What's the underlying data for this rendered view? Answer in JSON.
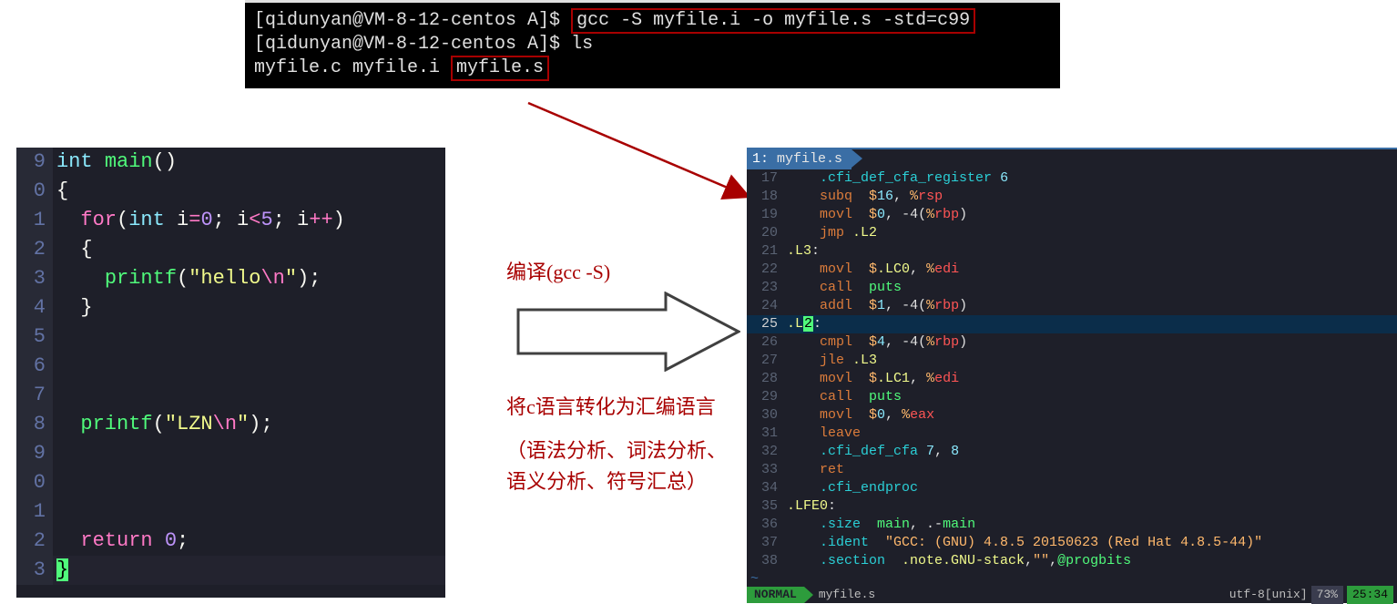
{
  "terminal": {
    "prompt": "[qidunyan@VM-8-12-centos A]$ ",
    "cmd1": "gcc -S myfile.i -o myfile.s -std=c99",
    "cmd2": "ls",
    "ls_out_a": "myfile.c  myfile.i ",
    "ls_out_b": "myfile.s"
  },
  "left_editor": {
    "lines": [
      {
        "n": "9",
        "seg": [
          {
            "t": "int ",
            "c": "ty"
          },
          {
            "t": "main",
            "c": "fn"
          },
          {
            "t": "()",
            "c": "pn"
          }
        ]
      },
      {
        "n": "0",
        "seg": [
          {
            "t": "{",
            "c": "pn"
          }
        ]
      },
      {
        "n": "1",
        "seg": [
          {
            "t": "  ",
            "c": "pn"
          },
          {
            "t": "for",
            "c": "kw"
          },
          {
            "t": "(",
            "c": "pn"
          },
          {
            "t": "int ",
            "c": "ty"
          },
          {
            "t": "i",
            "c": "pn"
          },
          {
            "t": "=",
            "c": "op"
          },
          {
            "t": "0",
            "c": "num"
          },
          {
            "t": "; i",
            "c": "pn"
          },
          {
            "t": "<",
            "c": "op"
          },
          {
            "t": "5",
            "c": "num"
          },
          {
            "t": "; i",
            "c": "pn"
          },
          {
            "t": "++",
            "c": "op"
          },
          {
            "t": ")",
            "c": "pn"
          }
        ]
      },
      {
        "n": "2",
        "seg": [
          {
            "t": "  {",
            "c": "pn"
          }
        ]
      },
      {
        "n": "3",
        "seg": [
          {
            "t": "    ",
            "c": "pn"
          },
          {
            "t": "printf",
            "c": "fn"
          },
          {
            "t": "(",
            "c": "pn"
          },
          {
            "t": "\"hello",
            "c": "str"
          },
          {
            "t": "\\n",
            "c": "esc"
          },
          {
            "t": "\"",
            "c": "str"
          },
          {
            "t": ");",
            "c": "pn"
          }
        ]
      },
      {
        "n": "4",
        "seg": [
          {
            "t": "  }",
            "c": "pn"
          }
        ]
      },
      {
        "n": "5",
        "seg": [
          {
            "t": "",
            "c": "pn"
          }
        ]
      },
      {
        "n": "6",
        "seg": [
          {
            "t": "",
            "c": "pn"
          }
        ]
      },
      {
        "n": "7",
        "seg": [
          {
            "t": "",
            "c": "pn"
          }
        ]
      },
      {
        "n": "8",
        "seg": [
          {
            "t": "  ",
            "c": "pn"
          },
          {
            "t": "printf",
            "c": "fn"
          },
          {
            "t": "(",
            "c": "pn"
          },
          {
            "t": "\"LZN",
            "c": "str"
          },
          {
            "t": "\\n",
            "c": "esc"
          },
          {
            "t": "\"",
            "c": "str"
          },
          {
            "t": ");",
            "c": "pn"
          }
        ]
      },
      {
        "n": "9",
        "seg": [
          {
            "t": "",
            "c": "pn"
          }
        ]
      },
      {
        "n": "0",
        "seg": [
          {
            "t": "",
            "c": "pn"
          }
        ]
      },
      {
        "n": "1",
        "seg": [
          {
            "t": "",
            "c": "pn"
          }
        ]
      },
      {
        "n": "2",
        "seg": [
          {
            "t": "  ",
            "c": "pn"
          },
          {
            "t": "return ",
            "c": "kw"
          },
          {
            "t": "0",
            "c": "num"
          },
          {
            "t": ";",
            "c": "pn"
          }
        ]
      },
      {
        "n": "3",
        "seg": [
          {
            "t": "}",
            "c": "cl-brace-hl"
          }
        ]
      }
    ]
  },
  "middle": {
    "title": "编译(gcc -S)",
    "desc1": "将c语言转化为汇编语言",
    "desc2": "（语法分析、词法分析、语义分析、符号汇总）"
  },
  "right_editor": {
    "tab_num": "1:",
    "tab_name": " myfile.s",
    "lines": [
      {
        "n": "17",
        "active": false,
        "seg": [
          {
            "t": "    ",
            "c": "r-wht"
          },
          {
            "t": ".cfi_def_cfa_register ",
            "c": "r-dir"
          },
          {
            "t": "6",
            "c": "r-num"
          }
        ]
      },
      {
        "n": "18",
        "active": false,
        "seg": [
          {
            "t": "    ",
            "c": "r-wht"
          },
          {
            "t": "subq  ",
            "c": "r-ins"
          },
          {
            "t": "$",
            "c": "r-orange"
          },
          {
            "t": "16",
            "c": "r-num"
          },
          {
            "t": ", ",
            "c": "r-wht"
          },
          {
            "t": "%",
            "c": "r-orange"
          },
          {
            "t": "rsp",
            "c": "r-red"
          }
        ]
      },
      {
        "n": "19",
        "active": false,
        "seg": [
          {
            "t": "    ",
            "c": "r-wht"
          },
          {
            "t": "movl  ",
            "c": "r-ins"
          },
          {
            "t": "$",
            "c": "r-orange"
          },
          {
            "t": "0",
            "c": "r-num"
          },
          {
            "t": ", ",
            "c": "r-wht"
          },
          {
            "t": "-4(",
            "c": "r-wht"
          },
          {
            "t": "%",
            "c": "r-orange"
          },
          {
            "t": "rbp",
            "c": "r-red"
          },
          {
            "t": ")",
            "c": "r-wht"
          }
        ]
      },
      {
        "n": "20",
        "active": false,
        "seg": [
          {
            "t": "    ",
            "c": "r-wht"
          },
          {
            "t": "jmp ",
            "c": "r-ins"
          },
          {
            "t": ".L2",
            "c": "r-lab"
          }
        ]
      },
      {
        "n": "21",
        "active": false,
        "seg": [
          {
            "t": ".L3",
            "c": "r-lab"
          },
          {
            "t": ":",
            "c": "r-wht"
          }
        ]
      },
      {
        "n": "22",
        "active": false,
        "seg": [
          {
            "t": "    ",
            "c": "r-wht"
          },
          {
            "t": "movl  ",
            "c": "r-ins"
          },
          {
            "t": "$",
            "c": "r-orange"
          },
          {
            "t": ".LC0",
            "c": "r-lab"
          },
          {
            "t": ", ",
            "c": "r-wht"
          },
          {
            "t": "%",
            "c": "r-orange"
          },
          {
            "t": "edi",
            "c": "r-red"
          }
        ]
      },
      {
        "n": "23",
        "active": false,
        "seg": [
          {
            "t": "    ",
            "c": "r-wht"
          },
          {
            "t": "call  ",
            "c": "r-ins"
          },
          {
            "t": "puts",
            "c": "r-green"
          }
        ]
      },
      {
        "n": "24",
        "active": false,
        "seg": [
          {
            "t": "    ",
            "c": "r-wht"
          },
          {
            "t": "addl  ",
            "c": "r-ins"
          },
          {
            "t": "$",
            "c": "r-orange"
          },
          {
            "t": "1",
            "c": "r-num"
          },
          {
            "t": ", ",
            "c": "r-wht"
          },
          {
            "t": "-4(",
            "c": "r-wht"
          },
          {
            "t": "%",
            "c": "r-orange"
          },
          {
            "t": "rbp",
            "c": "r-red"
          },
          {
            "t": ")",
            "c": "r-wht"
          }
        ]
      },
      {
        "n": "25",
        "active": true,
        "seg": [
          {
            "t": ".L",
            "c": "r-lab"
          },
          {
            "t": "2",
            "c": "r-cur"
          },
          {
            "t": ":",
            "c": "r-wht"
          }
        ]
      },
      {
        "n": "26",
        "active": false,
        "seg": [
          {
            "t": "    ",
            "c": "r-wht"
          },
          {
            "t": "cmpl  ",
            "c": "r-ins"
          },
          {
            "t": "$",
            "c": "r-orange"
          },
          {
            "t": "4",
            "c": "r-num"
          },
          {
            "t": ", ",
            "c": "r-wht"
          },
          {
            "t": "-4(",
            "c": "r-wht"
          },
          {
            "t": "%",
            "c": "r-orange"
          },
          {
            "t": "rbp",
            "c": "r-red"
          },
          {
            "t": ")",
            "c": "r-wht"
          }
        ]
      },
      {
        "n": "27",
        "active": false,
        "seg": [
          {
            "t": "    ",
            "c": "r-wht"
          },
          {
            "t": "jle ",
            "c": "r-ins"
          },
          {
            "t": ".L3",
            "c": "r-lab"
          }
        ]
      },
      {
        "n": "28",
        "active": false,
        "seg": [
          {
            "t": "    ",
            "c": "r-wht"
          },
          {
            "t": "movl  ",
            "c": "r-ins"
          },
          {
            "t": "$",
            "c": "r-orange"
          },
          {
            "t": ".LC1",
            "c": "r-lab"
          },
          {
            "t": ", ",
            "c": "r-wht"
          },
          {
            "t": "%",
            "c": "r-orange"
          },
          {
            "t": "edi",
            "c": "r-red"
          }
        ]
      },
      {
        "n": "29",
        "active": false,
        "seg": [
          {
            "t": "    ",
            "c": "r-wht"
          },
          {
            "t": "call  ",
            "c": "r-ins"
          },
          {
            "t": "puts",
            "c": "r-green"
          }
        ]
      },
      {
        "n": "30",
        "active": false,
        "seg": [
          {
            "t": "    ",
            "c": "r-wht"
          },
          {
            "t": "movl  ",
            "c": "r-ins"
          },
          {
            "t": "$",
            "c": "r-orange"
          },
          {
            "t": "0",
            "c": "r-num"
          },
          {
            "t": ", ",
            "c": "r-wht"
          },
          {
            "t": "%",
            "c": "r-orange"
          },
          {
            "t": "eax",
            "c": "r-red"
          }
        ]
      },
      {
        "n": "31",
        "active": false,
        "seg": [
          {
            "t": "    ",
            "c": "r-wht"
          },
          {
            "t": "leave",
            "c": "r-ins"
          }
        ]
      },
      {
        "n": "32",
        "active": false,
        "seg": [
          {
            "t": "    ",
            "c": "r-wht"
          },
          {
            "t": ".cfi_def_cfa ",
            "c": "r-dir"
          },
          {
            "t": "7",
            "c": "r-num"
          },
          {
            "t": ", ",
            "c": "r-wht"
          },
          {
            "t": "8",
            "c": "r-num"
          }
        ]
      },
      {
        "n": "33",
        "active": false,
        "seg": [
          {
            "t": "    ",
            "c": "r-wht"
          },
          {
            "t": "ret",
            "c": "r-ins"
          }
        ]
      },
      {
        "n": "34",
        "active": false,
        "seg": [
          {
            "t": "    ",
            "c": "r-wht"
          },
          {
            "t": ".cfi_endproc",
            "c": "r-dir"
          }
        ]
      },
      {
        "n": "35",
        "active": false,
        "seg": [
          {
            "t": ".LFE0",
            "c": "r-lab"
          },
          {
            "t": ":",
            "c": "r-wht"
          }
        ]
      },
      {
        "n": "36",
        "active": false,
        "seg": [
          {
            "t": "    ",
            "c": "r-wht"
          },
          {
            "t": ".size  ",
            "c": "r-dir"
          },
          {
            "t": "main",
            "c": "r-green"
          },
          {
            "t": ", .-",
            "c": "r-wht"
          },
          {
            "t": "main",
            "c": "r-green"
          }
        ]
      },
      {
        "n": "37",
        "active": false,
        "seg": [
          {
            "t": "    ",
            "c": "r-wht"
          },
          {
            "t": ".ident  ",
            "c": "r-dir"
          },
          {
            "t": "\"GCC: (GNU) 4.8.5 20150623 (Red Hat 4.8.5-44)\"",
            "c": "r-orange"
          }
        ]
      },
      {
        "n": "38",
        "active": false,
        "seg": [
          {
            "t": "    ",
            "c": "r-wht"
          },
          {
            "t": ".section  ",
            "c": "r-dir"
          },
          {
            "t": ".note.GNU-stack",
            "c": "r-lab"
          },
          {
            "t": ",",
            "c": "r-wht"
          },
          {
            "t": "\"\"",
            "c": "r-orange"
          },
          {
            "t": ",",
            "c": "r-wht"
          },
          {
            "t": "@progbits",
            "c": "r-green"
          }
        ]
      }
    ],
    "status": {
      "mode": "NORMAL",
      "file": "myfile.s",
      "encoding": "utf-8[unix]",
      "percent": "73%",
      "line": "25",
      "total": ":34"
    }
  }
}
